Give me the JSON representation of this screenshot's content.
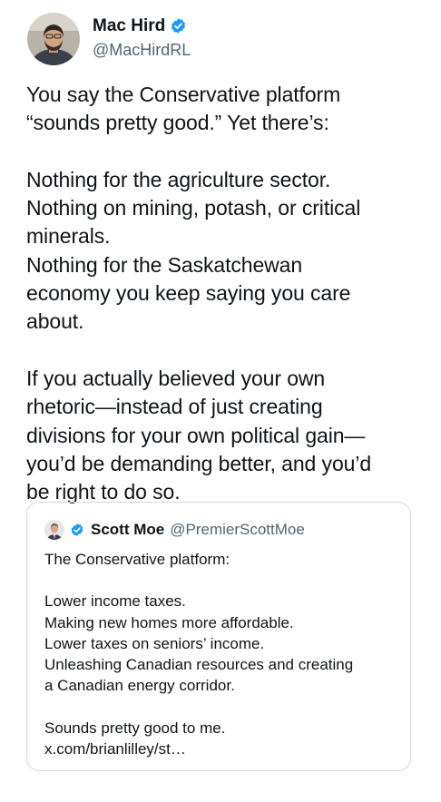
{
  "tweet": {
    "author": {
      "display_name": "Mac Hird",
      "handle": "@MacHirdRL",
      "avatar_icon": "person-avatar-icon",
      "verified_icon": "verified-badge-icon"
    },
    "text": "You say the Conservative platform\n“sounds pretty good.” Yet there’s:\n\nNothing for the agriculture sector.\nNothing on mining, potash, or critical\nminerals.\nNothing for the Saskatchewan\neconomy you keep saying you care\nabout.\n\nIf you actually believed your own\nrhetoric—instead of just creating\ndivisions for your own political gain—\nyou’d be demanding better, and you’d\nbe right to do so."
  },
  "quoted_tweet": {
    "author": {
      "display_name": "Scott Moe",
      "handle": "@PremierScottMoe",
      "avatar_icon": "person-avatar-icon",
      "verified_icon": "verified-badge-icon"
    },
    "text": "The Conservative platform:\n\nLower income taxes.\nMaking new homes more affordable.\nLower taxes on seniors’ income.\nUnleashing Canadian resources and creating\na Canadian energy corridor.\n\nSounds pretty good to me.\nx.com/brianlilley/st…"
  },
  "colors": {
    "text_primary": "#0f1419",
    "text_secondary": "#536471",
    "verified_blue": "#1d9bf0",
    "border": "#cfd9de",
    "background": "#ffffff"
  }
}
